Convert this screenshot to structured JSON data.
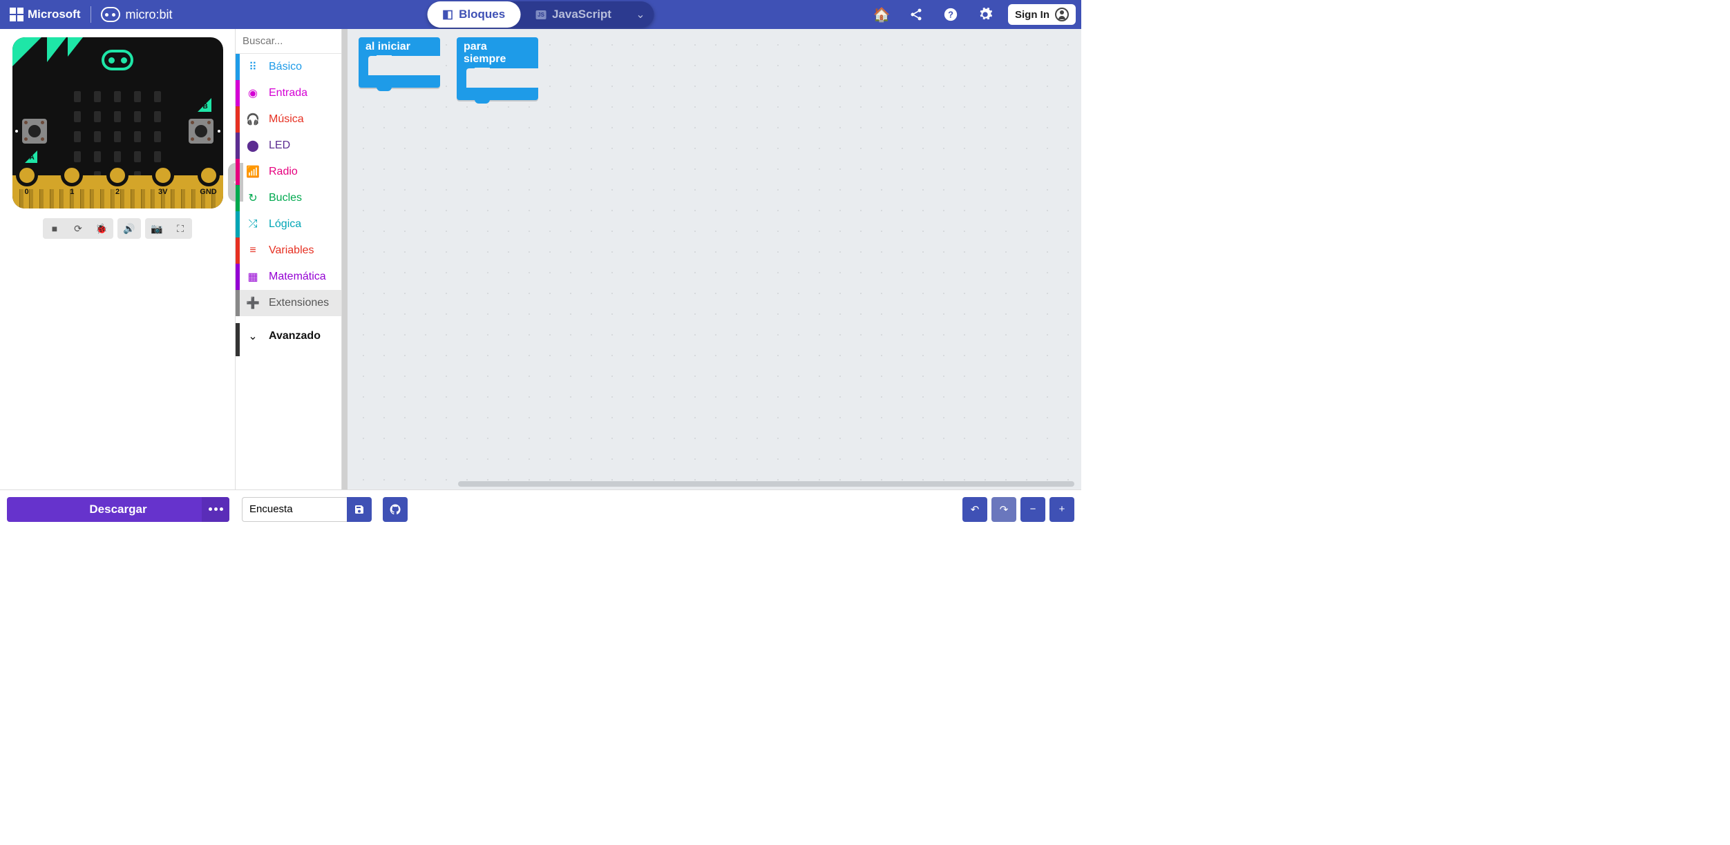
{
  "header": {
    "ms_label": "Microsoft",
    "mb_label": "micro:bit",
    "switch_blocks": "Bloques",
    "switch_js": "JavaScript",
    "signin": "Sign In"
  },
  "search": {
    "placeholder": "Buscar..."
  },
  "categories": [
    {
      "label": "Básico",
      "color": "#1e9be8",
      "text": "#1e9be8",
      "icon": "⠿"
    },
    {
      "label": "Entrada",
      "color": "#d400d4",
      "text": "#d400d4",
      "icon": "◉"
    },
    {
      "label": "Música",
      "color": "#e63022",
      "text": "#e63022",
      "icon": "🎧"
    },
    {
      "label": "LED",
      "color": "#5c2d91",
      "text": "#5c2d91",
      "icon": "⬤"
    },
    {
      "label": "Radio",
      "color": "#e6007e",
      "text": "#e6007e",
      "icon": "📶"
    },
    {
      "label": "Bucles",
      "color": "#00a94f",
      "text": "#00a94f",
      "icon": "↻"
    },
    {
      "label": "Lógica",
      "color": "#00a5b5",
      "text": "#00a5b5",
      "icon": "⤮"
    },
    {
      "label": "Variables",
      "color": "#e63022",
      "text": "#e63022",
      "icon": "≡"
    },
    {
      "label": "Matemática",
      "color": "#9400d3",
      "text": "#9400d3",
      "icon": "▦"
    }
  ],
  "extensions_label": "Extensiones",
  "advanced_label": "Avanzado",
  "blocks": {
    "on_start": "al iniciar",
    "forever": "para siempre"
  },
  "board_pins": [
    "0",
    "1",
    "2",
    "3V",
    "GND"
  ],
  "footer": {
    "download": "Descargar",
    "project_name": "Encuesta"
  }
}
